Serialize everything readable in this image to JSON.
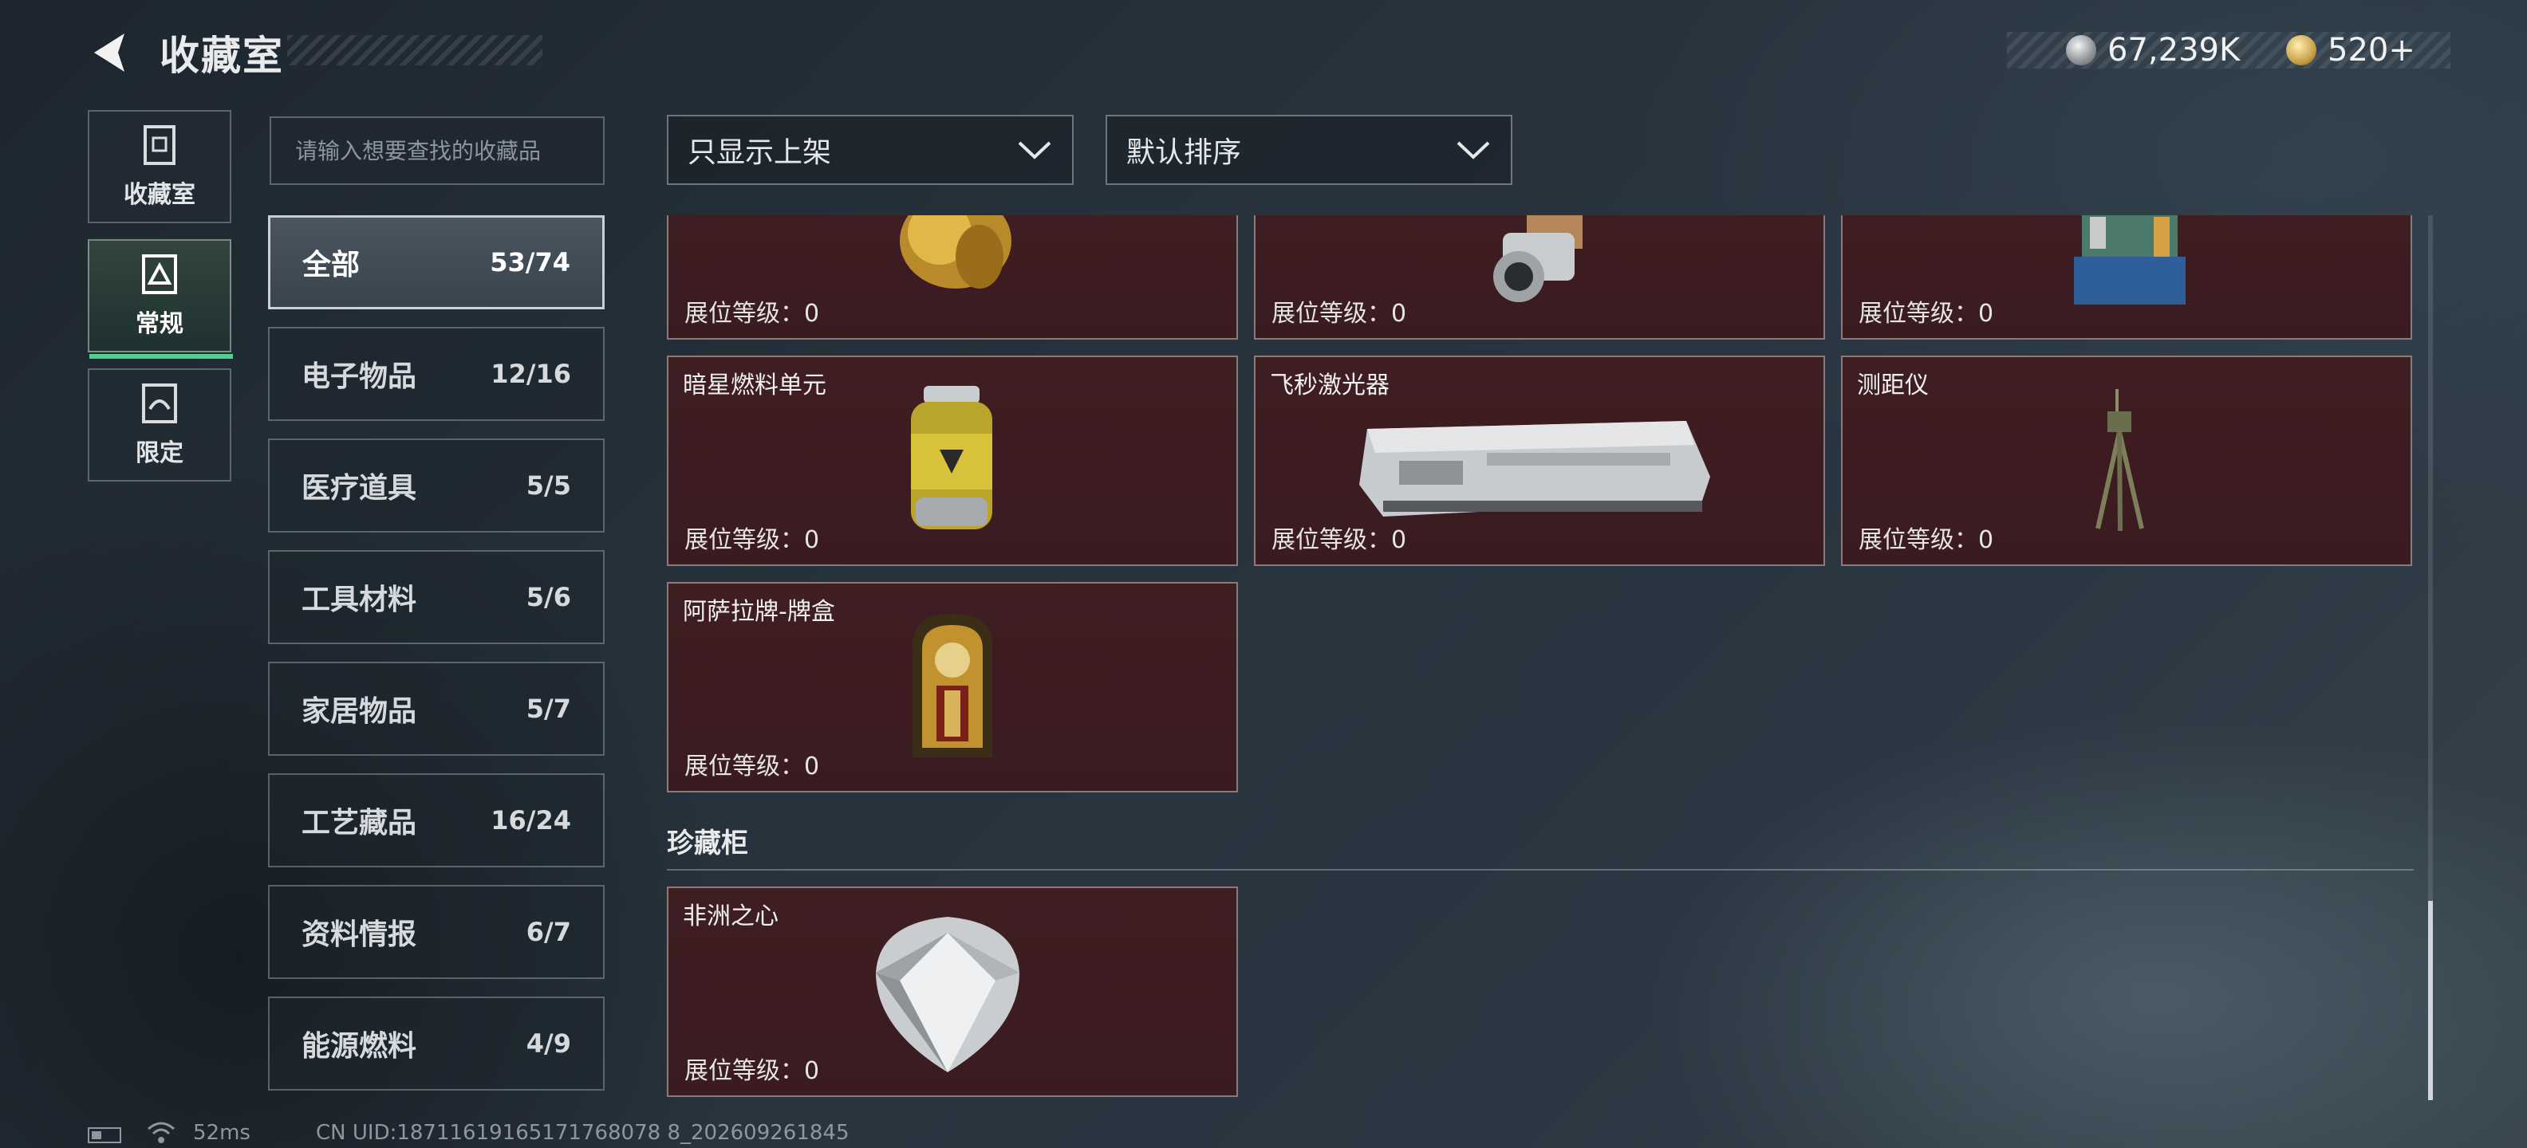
{
  "header": {
    "title": "收藏室",
    "currency": [
      {
        "icon": "silver-coin-icon",
        "value": "67,239K"
      },
      {
        "icon": "gold-coin-icon",
        "value": "520+"
      }
    ]
  },
  "left_nav": [
    {
      "label": "收藏室",
      "icon": "collection-room-icon"
    },
    {
      "label": "常规",
      "icon": "regular-icon",
      "active": true
    },
    {
      "label": "限定",
      "icon": "limited-icon"
    }
  ],
  "search": {
    "placeholder": "请输入想要查找的收藏品"
  },
  "categories": [
    {
      "name": "全部",
      "count": "53/74",
      "active": true
    },
    {
      "name": "电子物品",
      "count": "12/16"
    },
    {
      "name": "医疗道具",
      "count": "5/5"
    },
    {
      "name": "工具材料",
      "count": "5/6"
    },
    {
      "name": "家居物品",
      "count": "5/7"
    },
    {
      "name": "工艺藏品",
      "count": "16/24"
    },
    {
      "name": "资料情报",
      "count": "6/7"
    },
    {
      "name": "能源燃料",
      "count": "4/9"
    }
  ],
  "filters": {
    "display": "只显示上架",
    "sort": "默认排序"
  },
  "level_label": "展位等级：0",
  "items": [
    {
      "name": "",
      "art": "gold-statue"
    },
    {
      "name": "",
      "art": "lens-device"
    },
    {
      "name": "",
      "art": "circuit-device"
    },
    {
      "name": "暗星燃料单元",
      "art": "fuel-canister"
    },
    {
      "name": "飞秒激光器",
      "art": "laser-box"
    },
    {
      "name": "测距仪",
      "art": "tripod"
    },
    {
      "name": "阿萨拉牌-牌盒",
      "art": "card-box"
    }
  ],
  "showcase": {
    "title": "珍藏柜",
    "items": [
      {
        "name": "非洲之心",
        "art": "diamond"
      }
    ]
  },
  "footer": {
    "ping": "52ms",
    "uid": "CN UID:18711619165171768078 8_202609261845"
  },
  "colors": {
    "accent_green": "#4fd28a",
    "card_bg": "#3f1e22",
    "card_border": "#8b7a7a"
  }
}
